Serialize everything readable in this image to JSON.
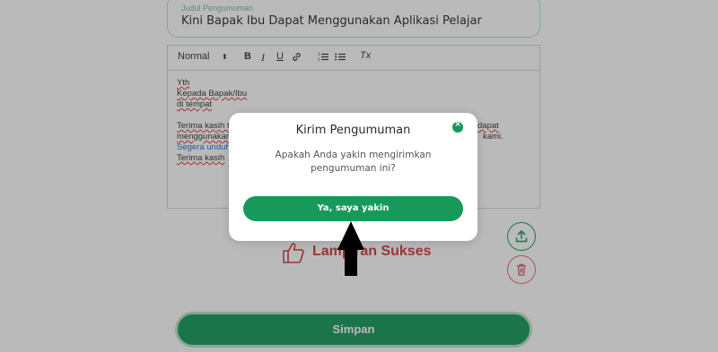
{
  "form": {
    "title_label": "Judul Pengumuman",
    "title_value": "Kini Bapak Ibu Dapat Menggunakan Aplikasi Pelajar"
  },
  "editor": {
    "toolbar": {
      "format_select": "Normal",
      "bold": "B",
      "italic": "I",
      "underline": "U",
      "clear_format": "Tx"
    },
    "lines": {
      "l1": "Yth",
      "l2": "Kepada Bapak/Ibu",
      "l3": "di tempat",
      "l4a": "Terima kasih te",
      "l4b": "dapat",
      "l5a": "menggunakan a",
      "l5b": "kami.",
      "l6": "Segera unduh a",
      "l7": "Terima kasih"
    }
  },
  "background": {
    "lampiran_text": "Lampiran Sukses",
    "save_button": "Simpan"
  },
  "modal": {
    "title": "Kirim Pengumuman",
    "message": "Apakah Anda yakin mengirimkan pengumuman ini?",
    "confirm_button": "Ya, saya yakin",
    "close_glyph": "×"
  },
  "colors": {
    "primary_green": "#17995a",
    "danger_red": "#d23b3b",
    "overlay": "rgba(40,40,40,0.32)"
  },
  "icons": [
    "close-icon",
    "upload-icon",
    "trash-icon",
    "thumbs-up-icon",
    "link-icon",
    "ordered-list-icon",
    "bullet-list-icon",
    "arrow-up-icon"
  ]
}
